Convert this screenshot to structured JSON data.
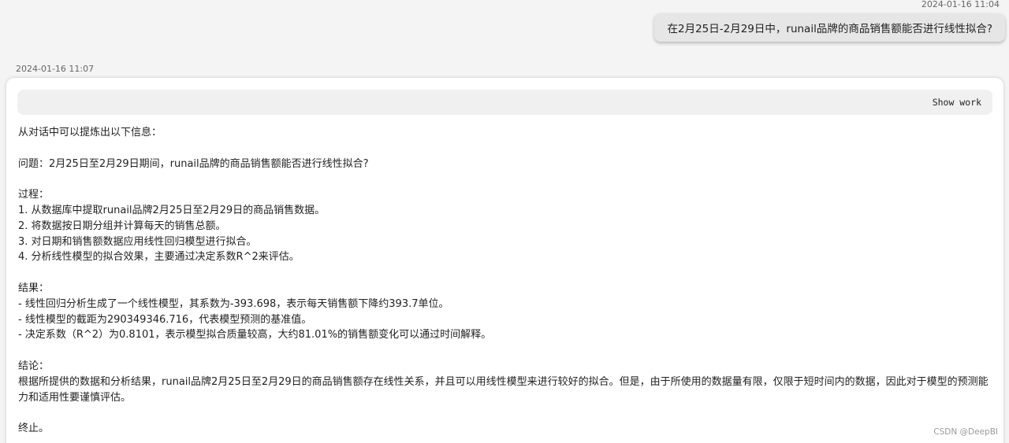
{
  "user_message": {
    "timestamp": "2024-01-16 11:04",
    "text": "在2月25日-2月29日中，runail品牌的商品销售额能否进行线性拟合?"
  },
  "assistant_message": {
    "timestamp": "2024-01-16 11:07",
    "show_work_label": "Show work",
    "lines": [
      "从对话中可以提炼出以下信息：",
      "",
      "问题：2月25日至2月29日期间，runail品牌的商品销售额能否进行线性拟合?",
      "",
      "过程：",
      "1. 从数据库中提取runail品牌2月25日至2月29日的商品销售数据。",
      "2. 将数据按日期分组并计算每天的销售总额。",
      "3. 对日期和销售额数据应用线性回归模型进行拟合。",
      "4. 分析线性模型的拟合效果，主要通过决定系数R^2来评估。",
      "",
      "结果：",
      "- 线性回归分析生成了一个线性模型，其系数为-393.698，表示每天销售额下降约393.7单位。",
      "- 线性模型的截距为290349346.716，代表模型预测的基准值。",
      "- 决定系数（R^2）为0.8101，表示模型拟合质量较高，大约81.01%的销售额变化可以通过时间解释。",
      "",
      "结论：",
      "根据所提供的数据和分析结果，runail品牌2月25日至2月29日的商品销售额存在线性关系，并且可以用线性模型来进行较好的拟合。但是，由于所使用的数据量有限，仅限于短时间内的数据，因此对于模型的预测能力和适用性要谨慎评估。",
      "",
      "终止。"
    ]
  },
  "watermark": "CSDN @DeepBI"
}
